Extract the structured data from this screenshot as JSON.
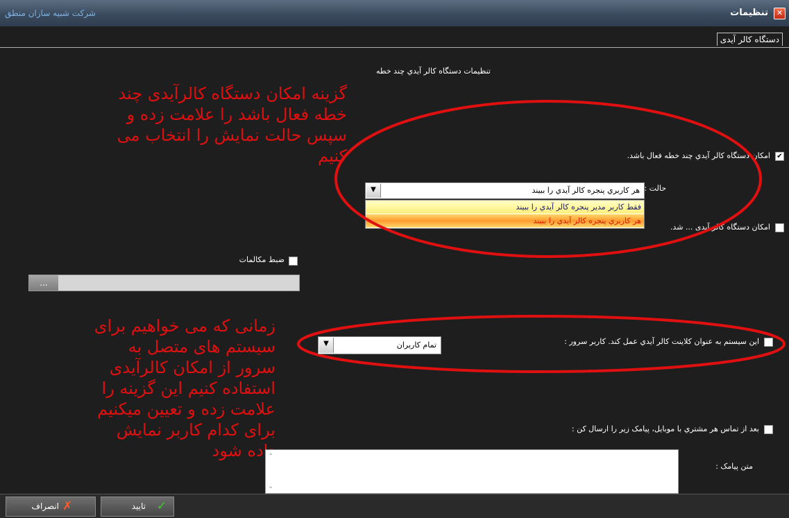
{
  "window": {
    "title": "تنظیمات",
    "company": "شرکت شبیه سازان منطق"
  },
  "tab": {
    "label": "دستگاه کالر آیدی"
  },
  "section_title": "تنظیمات دستگاه کالر آيدي چند خطه",
  "multiline": {
    "checkbox_label": "امکان دستگاه کالر آيدي چند خطه فعال باشد.",
    "checked": true,
    "mode_label": "حالت :",
    "mode_value": "هر کاربري پنجره کالر آيدي را ببيند",
    "options": [
      "فقط کاربر مدير پنجره کالر آيدي را ببيند",
      "هر کاربري پنجره کالر آيدي را ببيند"
    ],
    "second_checkbox_label": "امکان دستگاه کالر آیدی ... شد."
  },
  "recording": {
    "label": "ضبط مکالمات",
    "browse_label": "..."
  },
  "client": {
    "label": "اين سيستم به عنوان کلاينت کالر آيدي عمل کند. کاربر سرور :",
    "value": "تمام کاربران"
  },
  "sms": {
    "checkbox_label": "بعد از تماس هر مشتري با موبايل، پيامک زير را ارسال کن :",
    "text_label": "متن پيامک :"
  },
  "annotations": {
    "top": [
      "گزینه امکان دستگاه کالرآیدی چند",
      "خطه فعال باشد را علامت زده و",
      "سپس حالت نمایش را انتخاب می",
      "کنیم"
    ],
    "bottom": [
      "زمانی که می خواهیم برای",
      "سیستم های متصل به",
      "سرور از امکان کالرآیدی",
      "استفاده کنیم این گزینه را",
      "علامت زده و تعیین میکنیم",
      "برای کدام کاربر نمایش",
      "داده شود"
    ]
  },
  "buttons": {
    "ok": "تایید",
    "cancel": "انصراف"
  },
  "colors": {
    "annotation": "#e01010",
    "titlebar": "#3b4b5e",
    "background": "#1e1e1e"
  }
}
